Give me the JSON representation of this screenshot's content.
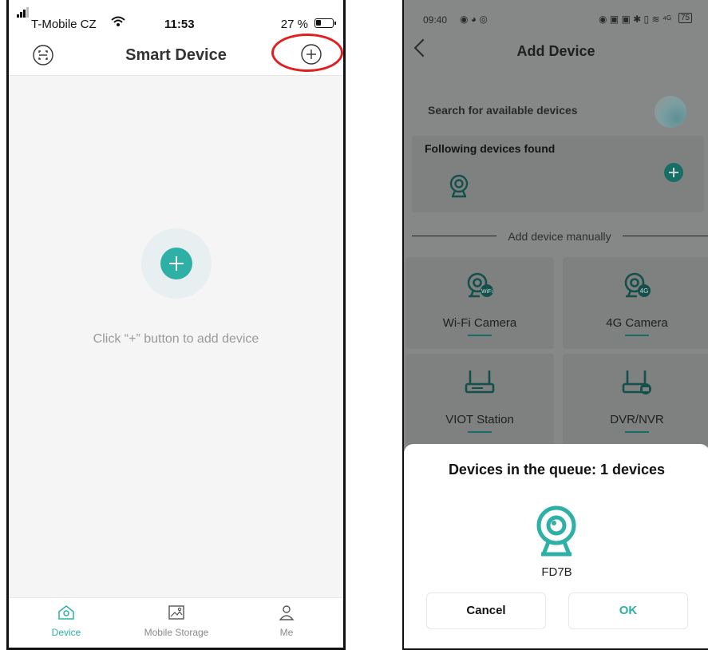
{
  "left": {
    "status": {
      "carrier": "T-Mobile CZ",
      "time": "11:53",
      "battery": "27 %"
    },
    "header": {
      "title": "Smart Device",
      "scan_icon": "scan-icon",
      "add_icon": "plus-circle-icon"
    },
    "empty": {
      "hint": "Click “+” button to add device",
      "add_icon": "plus-icon"
    },
    "tabs": [
      {
        "label": "Device",
        "icon": "home-icon",
        "active": true
      },
      {
        "label": "Mobile Storage",
        "icon": "image-icon",
        "active": false
      },
      {
        "label": "Me",
        "icon": "person-icon",
        "active": false
      }
    ]
  },
  "right": {
    "status": {
      "time": "09:40",
      "battery": "75"
    },
    "header": {
      "title": "Add Device",
      "back_icon": "chevron-left-icon"
    },
    "search": {
      "label": "Search for available devices"
    },
    "found": {
      "title": "Following devices found"
    },
    "manual": {
      "label": "Add device manually"
    },
    "device_types": [
      {
        "label": "Wi-Fi Camera",
        "badge": "WiFi",
        "icon": "camera-icon"
      },
      {
        "label": "4G Camera",
        "badge": "4G",
        "icon": "camera-icon"
      },
      {
        "label": "VIOT Station",
        "icon": "router-icon"
      },
      {
        "label": "DVR/NVR",
        "icon": "recorder-icon"
      }
    ],
    "dialog": {
      "title": "Devices in the queue: 1 devices",
      "device_name": "FD7B",
      "cancel": "Cancel",
      "ok": "OK"
    }
  },
  "colors": {
    "accent": "#2eb0a6",
    "highlight": "#e02020",
    "overlay": "#868787"
  }
}
